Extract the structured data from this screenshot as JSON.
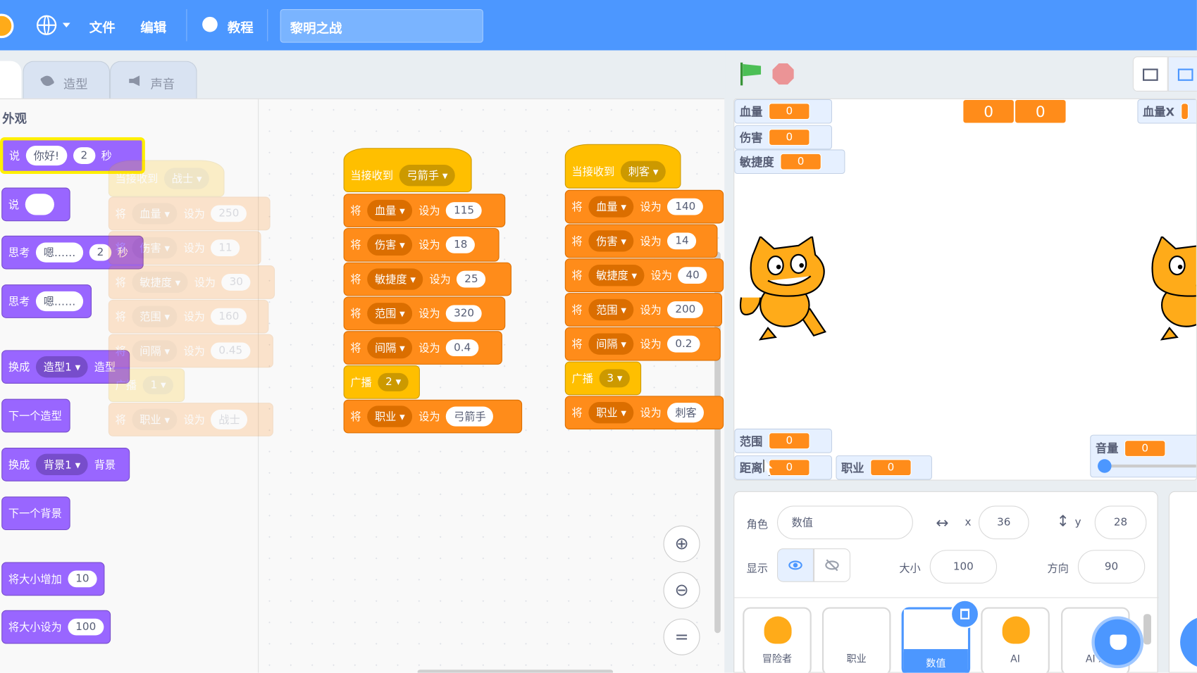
{
  "menu": {
    "file": "文件",
    "edit": "编辑",
    "tutorial": "教程",
    "project_title": "黎明之战"
  },
  "tabs": {
    "costumes": "造型",
    "sounds": "声音"
  },
  "palette": {
    "category": "外观",
    "say_timed": {
      "label": "说",
      "text": "你好!",
      "secs": "2",
      "unit": "秒"
    },
    "say": {
      "label": "说"
    },
    "think_timed": {
      "label": "思考",
      "text": "嗯……",
      "secs": "2",
      "unit": "秒"
    },
    "think": {
      "label": "思考",
      "text": "嗯……"
    },
    "switch_costume": {
      "label": "换成",
      "value": "造型1",
      "unit": "造型"
    },
    "next_costume": "下一个造型",
    "switch_backdrop": {
      "label": "换成",
      "value": "背景1",
      "unit": "背景"
    },
    "next_backdrop": "下一个背景",
    "change_size": {
      "label": "将大小增加",
      "value": "10"
    },
    "set_size": {
      "label": "将大小设为",
      "value": "100"
    }
  },
  "faded_script": {
    "hat": "当接收到",
    "hat_value": "战士",
    "set": "将",
    "setto": "设为",
    "broadcast": "广播",
    "broadcast_value": "1",
    "rows": [
      {
        "var": "血量",
        "val": "250"
      },
      {
        "var": "伤害",
        "val": "11"
      },
      {
        "var": "敏捷度",
        "val": "30"
      },
      {
        "var": "范围",
        "val": "160"
      },
      {
        "var": "间隔",
        "val": "0.45"
      }
    ],
    "last": {
      "var": "职业",
      "val": "战士"
    }
  },
  "script_archer": {
    "hat": "当接收到",
    "hat_value": "弓箭手",
    "set": "将",
    "setto": "设为",
    "broadcast": "广播",
    "broadcast_value": "2",
    "rows": [
      {
        "var": "血量",
        "val": "115"
      },
      {
        "var": "伤害",
        "val": "18"
      },
      {
        "var": "敏捷度",
        "val": "25"
      },
      {
        "var": "范围",
        "val": "320"
      },
      {
        "var": "间隔",
        "val": "0.4"
      }
    ],
    "last": {
      "var": "职业",
      "val": "弓箭手"
    }
  },
  "script_assassin": {
    "hat": "当接收到",
    "hat_value": "刺客",
    "set": "将",
    "setto": "设为",
    "broadcast": "广播",
    "broadcast_value": "3",
    "rows": [
      {
        "var": "血量",
        "val": "140"
      },
      {
        "var": "伤害",
        "val": "14"
      },
      {
        "var": "敏捷度",
        "val": "40"
      },
      {
        "var": "范围",
        "val": "200"
      },
      {
        "var": "间隔",
        "val": "0.2"
      }
    ],
    "last": {
      "var": "职业",
      "val": "刺客"
    }
  },
  "monitors": {
    "hp": {
      "label": "血量",
      "val": "0"
    },
    "dmg": {
      "label": "伤害",
      "val": "0"
    },
    "agi": {
      "label": "敏捷度",
      "val": "0"
    },
    "range": {
      "label": "范围",
      "val": "0"
    },
    "dist": {
      "label": "距离",
      "val": "0"
    },
    "job": {
      "label": "职业",
      "val": "0"
    },
    "hpx": {
      "label": "血量X"
    },
    "big1": "0",
    "big2": "0",
    "volume": {
      "label": "音量",
      "val": "0"
    }
  },
  "sprite_info": {
    "sprite_label": "角色",
    "sprite_name": "数值",
    "x_label": "x",
    "x": "36",
    "y_label": "y",
    "y": "28",
    "show_label": "显示",
    "size_label": "大小",
    "size": "100",
    "dir_label": "方向",
    "direction": "90"
  },
  "sprites": [
    "冒险者",
    "职业",
    "数值",
    "AI",
    "AI X"
  ],
  "colors": {
    "menu": "#4c97ff",
    "looks": "#9966ff",
    "variables": "#ff8c1a",
    "events": "#ffbf00"
  }
}
